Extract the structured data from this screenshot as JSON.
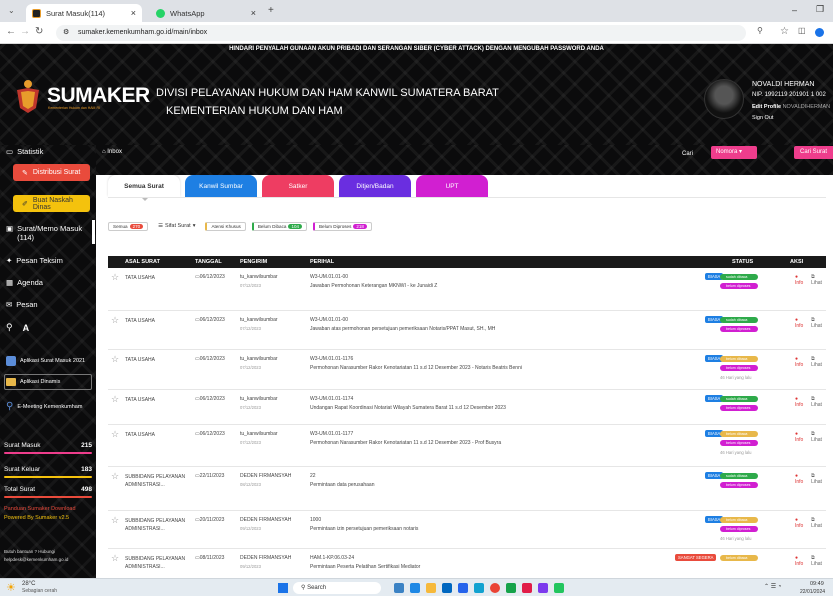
{
  "browser": {
    "tabs": [
      {
        "label": "Surat Masuk(114)",
        "close": "×"
      },
      {
        "label": "WhatsApp",
        "close": "×"
      }
    ],
    "new_tab": "+",
    "url": "sumaker.kemenkumham.go.id/main/inbox"
  },
  "header": {
    "announcement": "HINDARI PENYALAH GUNAAN AKUN PRIBADI DAN SERANGAN SIBER (CYBER ATTACK) DENGAN MENGUBAH PASSWORD ANDA",
    "brand": "SUMAKER",
    "brand_sub": "Kementerian Hukum dan HAM RI",
    "division": "DIVISI PELAYANAN HUKUM DAN HAM KANWIL SUMATERA BARAT",
    "ministry": "KEMENTERIAN HUKUM DAN HAM",
    "user": {
      "name": "NOVALDI HERMAN",
      "nip": "NIP. 1992119 201901 1 002",
      "edit_label": "Edit Profile",
      "edit_user": "NOVALDIHERMAN",
      "signout": "Sign Out"
    }
  },
  "sidebar": {
    "statistik": "Statistik",
    "distribusi": "Distribusi Surat",
    "buat_naskah": "Buat Naskah Dinas",
    "surat_masuk": "Surat/Memo Masuk (114)",
    "pesan_teks": "Pesan Teksim",
    "agenda": "Agenda",
    "pesan": "Pesan",
    "app1": "Aplikasi Surat Masuk 2021",
    "app2": "Aplikasi Dinamis",
    "app3": "E-Meeting Kemenkumham",
    "counts": [
      {
        "label": "Surat Masuk",
        "value": "215"
      },
      {
        "label": "Surat Keluar",
        "value": "183"
      },
      {
        "label": "Total Surat",
        "value": "498"
      }
    ],
    "panduan": "Panduan Sumaker Download",
    "powered": "Powered By Sumaker v2.5",
    "help": "Butuh bantuan ? Hubungi",
    "email": "helpdesk@kemenkumham.go.id",
    "colors": {
      "distribusi": "#e94b3c",
      "buat": "#f4c20d",
      "hr1": "#ee3d8c",
      "hr2": "#f4c20d",
      "hr3": "#e94b3c"
    }
  },
  "strip": {
    "breadcrumb": "Inbox",
    "cari": "Cari",
    "search_type": "Nomora",
    "search_placeholder": "Cari Surat"
  },
  "tabs": [
    {
      "label": "Semua Surat",
      "color": "#ffffff"
    },
    {
      "label": "Kanwil Sumbar",
      "color": "#1e7fe3"
    },
    {
      "label": "Satker",
      "color": "#ee3d62"
    },
    {
      "label": "Ditjen/Badan",
      "color": "#6a2ee0"
    },
    {
      "label": "UPT",
      "color": "#d11fd1"
    }
  ],
  "filters": [
    {
      "label": "Semua",
      "count": "270",
      "color": "#e94b3c"
    },
    {
      "label": "Sifat Surat",
      "dropdown": "▾"
    },
    {
      "label": "Atensi Khusus"
    },
    {
      "label": "Belum Dibaca",
      "count": "104",
      "color": "#2eaa4a"
    },
    {
      "label": "Belum Diproses",
      "count": "218",
      "color": "#d11fd1"
    }
  ],
  "table": {
    "headers": [
      "ASAL SURAT",
      "TANGGAL",
      "PENGIRIM",
      "PERIHAL",
      "STATUS",
      "AKSI"
    ],
    "rows": [
      {
        "asal": "TATA USAHA",
        "tanggal": "06/12/2023",
        "pengirim": "tu_kanwilsumbar",
        "pengirim_sub": "07/12/2023",
        "nomor": "W3-UM.01.01-00",
        "perihal": "Jawaban Permohonan Keterangan MKNWI - ke Junaidi Z",
        "sifat": "BIASA",
        "status": [
          "sudah dibaca",
          "belum diproses"
        ],
        "info": "Info",
        "lihat": "Lihat"
      },
      {
        "asal": "TATA USAHA",
        "tanggal": "06/12/2023",
        "pengirim": "tu_kanwilsumbar",
        "pengirim_sub": "07/12/2023",
        "nomor": "W3-UM.01.01-00",
        "perihal": "Jawaban atas permohonan persetujuan pemeriksaan Notaris/PPAT Masut, SH., MH",
        "sifat": "BIASA",
        "status": [
          "sudah dibaca",
          "belum diproses"
        ],
        "info": "Info",
        "lihat": "Lihat"
      },
      {
        "asal": "TATA USAHA",
        "tanggal": "06/12/2023",
        "pengirim": "tu_kanwilsumbar",
        "pengirim_sub": "07/12/2023",
        "nomor": "W3-UM.01.01-1176",
        "perihal": "Permohonan Narasumber Rakor Kenotariatan 11 s.d 12 Desember 2023 - Notaris Beatris Benni",
        "sifat": "BIASA",
        "status": [
          "belum dibaca",
          "belum diproses"
        ],
        "note": "46 Hari yang lalu",
        "info": "Info",
        "lihat": "Lihat"
      },
      {
        "asal": "TATA USAHA",
        "tanggal": "06/12/2023",
        "pengirim": "tu_kanwilsumbar",
        "pengirim_sub": "07/12/2023",
        "nomor": "W3-UM.01.01-1174",
        "perihal": "Undangan Rapat Koordinasi Notariat Wilayah Sumatera Barat 11 s.d 12 Desember 2023",
        "sifat": "BIASA",
        "status": [
          "sudah dibaca",
          "belum diproses"
        ],
        "info": "Info",
        "lihat": "Lihat"
      },
      {
        "asal": "TATA USAHA",
        "tanggal": "06/12/2023",
        "pengirim": "tu_kanwilsumbar",
        "pengirim_sub": "07/12/2023",
        "nomor": "W3-UM.01.01-1177",
        "perihal": "Permohonan Narasumber Rakor Kenotariatan 11 s.d 12 Desember 2023 - Prof Busyra",
        "sifat": "BIASA",
        "status": [
          "belum dibaca",
          "belum diproses"
        ],
        "note": "46 Hari yang lalu",
        "info": "Info",
        "lihat": "Lihat"
      },
      {
        "asal": "SUBBIDANG PELAYANAN ADMINISTRASI...",
        "tanggal": "22/11/2023",
        "pengirim": "DEDEN FIRMANSYAH",
        "pengirim_sub": "08/12/2023",
        "nomor": "22",
        "perihal": "Permintaan data perusahaan",
        "sifat": "BIASA",
        "status": [
          "sudah dibaca",
          "belum diproses"
        ],
        "info": "Info",
        "lihat": "Lihat"
      },
      {
        "asal": "SUBBIDANG PELAYANAN ADMINISTRASI...",
        "tanggal": "20/11/2023",
        "pengirim": "DEDEN FIRMANSYAH",
        "pengirim_sub": "09/12/2023",
        "nomor": "1000",
        "perihal": "Permintaan izin persetujuan pemeriksaan notaris",
        "sifat": "BIASA",
        "status": [
          "belum dibaca",
          "belum diproses"
        ],
        "note": "46 Hari yang lalu",
        "info": "Info",
        "lihat": "Lihat"
      },
      {
        "asal": "SUBBIDANG PELAYANAN ADMINISTRASI...",
        "tanggal": "08/11/2023",
        "pengirim": "DEDEN FIRMANSYAH",
        "pengirim_sub": "09/12/2023",
        "nomor": "HAM.1-KP.06.03-24",
        "perihal": "Permintaan Peserta Pelatihan Sertifikasi Mediator",
        "sifat": "SANGAT SEGERA",
        "status": [
          "belum dibaca"
        ],
        "info": "Info",
        "lihat": "Lihat"
      }
    ]
  },
  "taskbar": {
    "weather": "28°C",
    "weather_sub": "Sebagian cerah",
    "search": "Search",
    "time": "09:49",
    "date": "22/01/2024"
  },
  "icons": [
    "menu-icon",
    "back-icon",
    "forward-icon",
    "reload-icon",
    "site-info-icon",
    "star-icon",
    "extension-icon",
    "profile-icon",
    "minimize-icon",
    "search-icon",
    "windows-icon"
  ]
}
